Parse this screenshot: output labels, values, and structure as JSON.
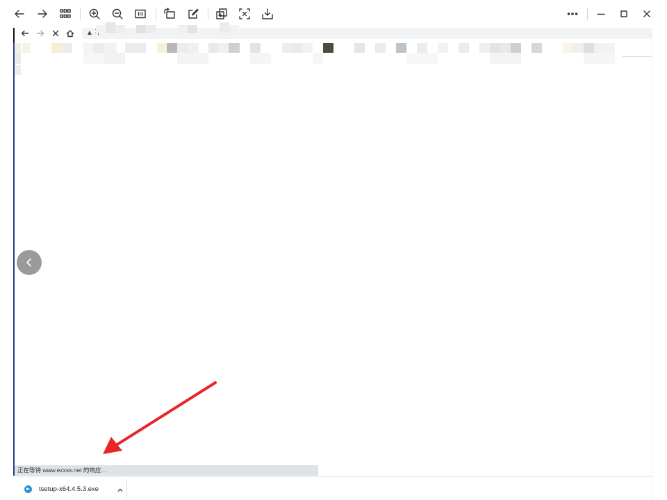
{
  "toolbar": {
    "left_buttons": [
      "back-arrow-icon",
      "forward-arrow-icon",
      "grid-view-icon",
      "zoom-in-icon",
      "zoom-out-icon",
      "actual-size-icon",
      "rotate-icon",
      "edit-icon",
      "copy-image-icon",
      "crop-screenshot-icon",
      "download-icon"
    ],
    "right_buttons": [
      "more-options-icon",
      "minimize-icon",
      "maximize-icon",
      "close-icon"
    ]
  },
  "browser": {
    "address_prefix": "▲ 不",
    "status_text": "正在等待 www.ezxss.net 的响应...",
    "download": {
      "file_name": "tsetup-x64.4.5.3.exe"
    }
  },
  "colors": {
    "accent_edge": "#1c3f8c",
    "arrow": "#e8262a",
    "prev_button_bg": "#9a9a9a",
    "download_icon": "#2c8fd6"
  }
}
